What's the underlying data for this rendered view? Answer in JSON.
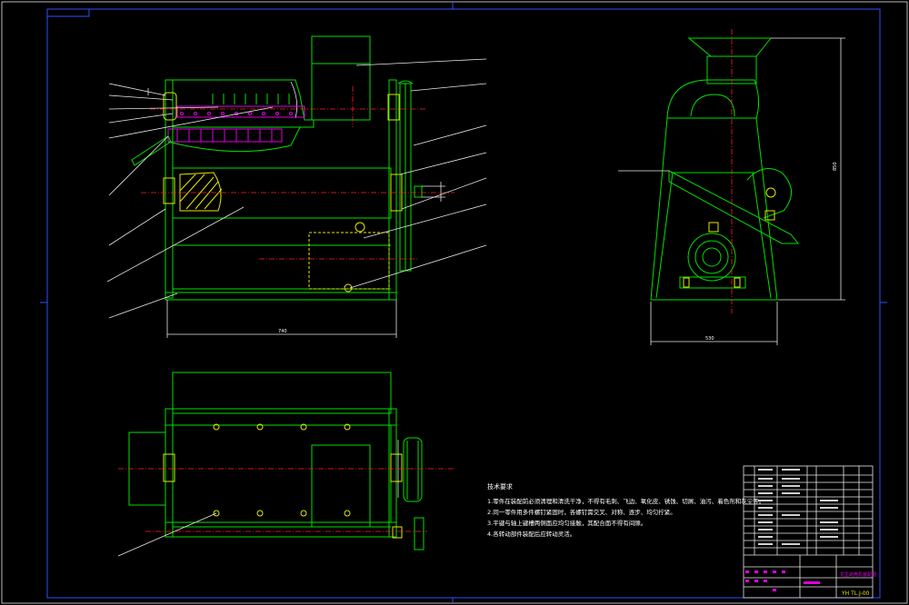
{
  "drawing": {
    "number": "YH TL.J-00",
    "title_text": "花生剥壳机装配图"
  },
  "technical_requirements": {
    "heading": "技术要求",
    "items": [
      "1.零件在装配前必须清理和清洗干净，不得有毛刺、飞边、氧化皮、锈蚀、切屑、油污、着色剂和灰尘等。",
      "2.同一零件用多件螺钉紧固时，各螺钉需交叉、对称、逐步、均匀拧紧。",
      "3.平键与轴上键槽两侧面应均匀接触，其配合面不得有间隙。",
      "4.各转动部件装配后应转动灵活。"
    ]
  },
  "colors": {
    "background": "#000000",
    "outline": "#00e000",
    "centerline": "#ff2020",
    "leader": "#e8e8e8",
    "frame": "#3050ff",
    "detail": "#e000e0",
    "hidden": "#e8e800"
  }
}
